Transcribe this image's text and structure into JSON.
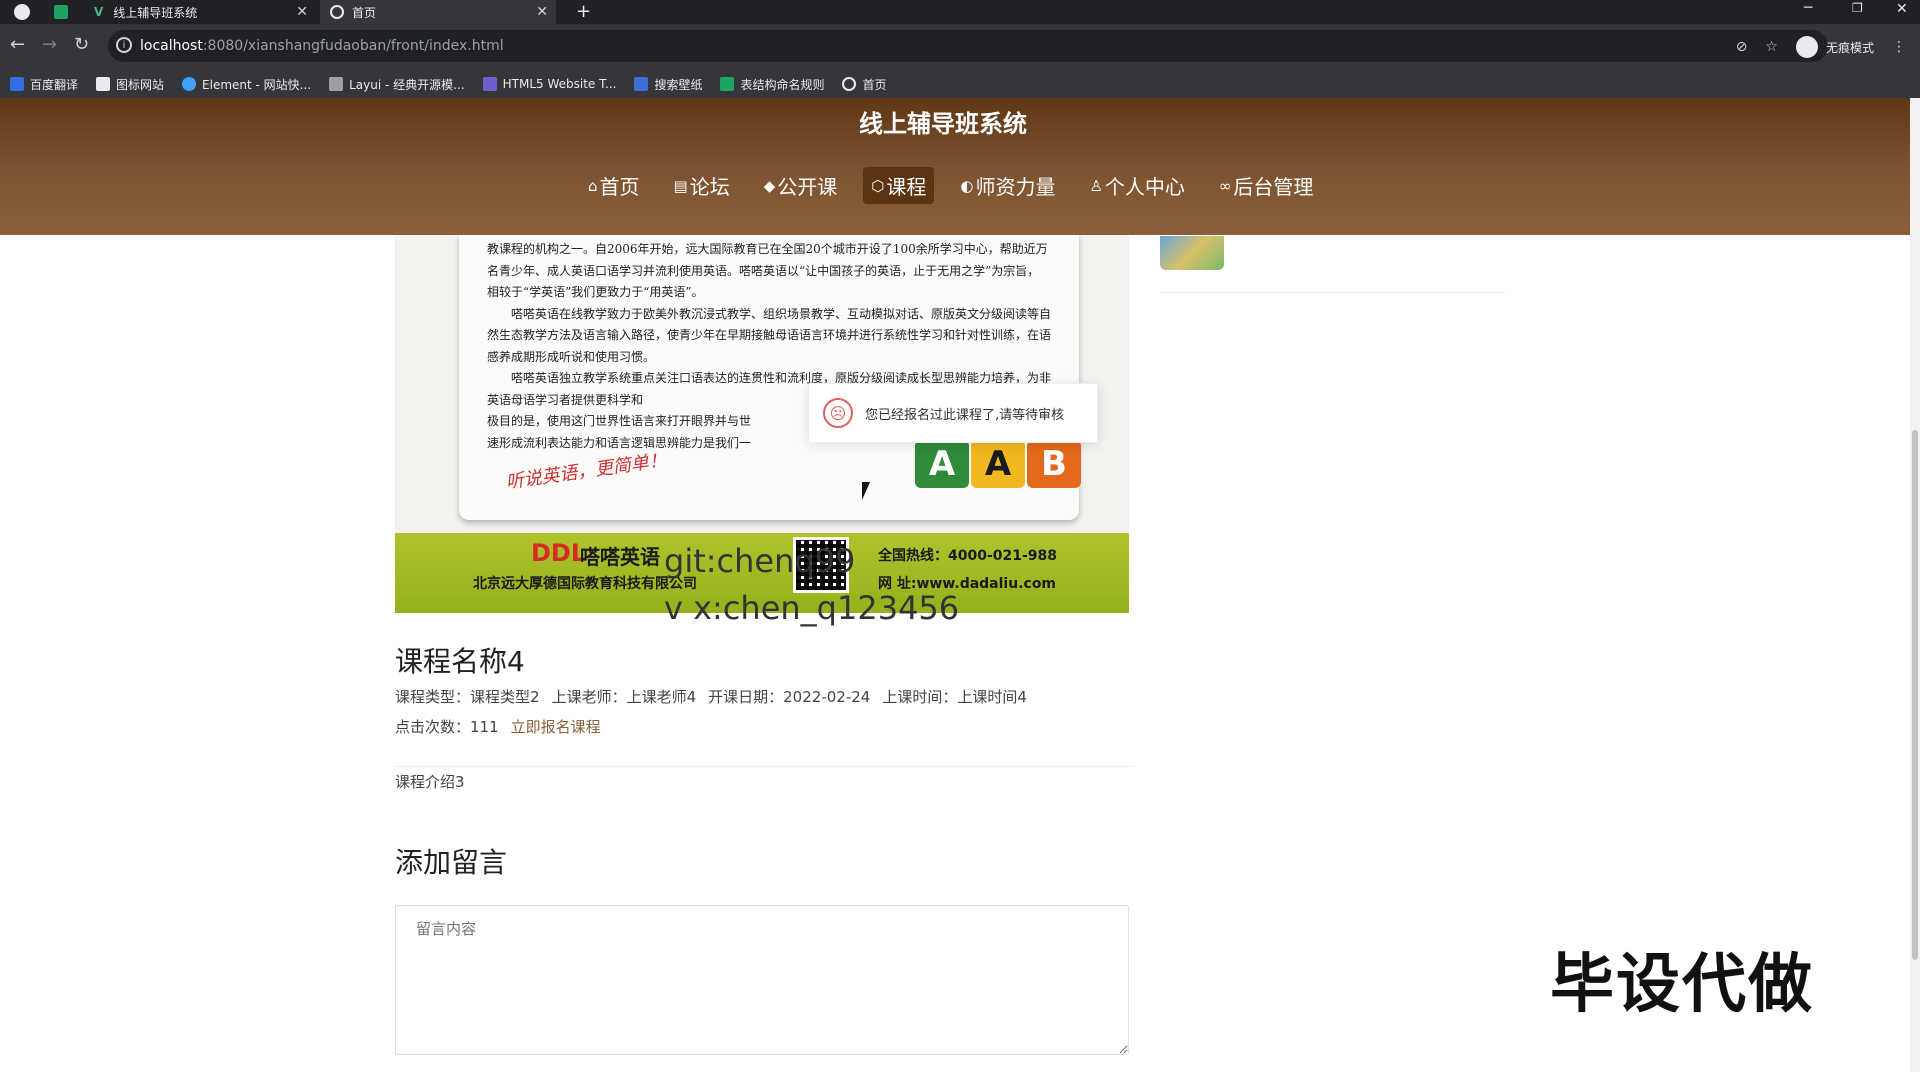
{
  "browser": {
    "tabs": [
      {
        "label": "线上辅导班系统",
        "active": false
      },
      {
        "label": "首页",
        "active": true
      }
    ],
    "url_host": "localhost",
    "url_path": ":8080/xianshangfudaoban/front/index.html",
    "incognito_label": "无痕模式",
    "bookmarks": [
      "百度翻译",
      "图标网站",
      "Element - 网站快...",
      "Layui - 经典开源模...",
      "HTML5 Website T...",
      "搜索壁纸",
      "表结构命名规则",
      "首页"
    ]
  },
  "site": {
    "title": "线上辅导班系统",
    "nav": [
      {
        "label": "首页",
        "icon": "home-icon",
        "active": false
      },
      {
        "label": "论坛",
        "icon": "forum-icon",
        "active": false
      },
      {
        "label": "公开课",
        "icon": "graduation-cap-icon",
        "active": false
      },
      {
        "label": "课程",
        "icon": "course-icon",
        "active": true
      },
      {
        "label": "师资力量",
        "icon": "teacher-icon",
        "active": false
      },
      {
        "label": "个人中心",
        "icon": "user-icon",
        "active": false
      },
      {
        "label": "后台管理",
        "icon": "link-icon",
        "active": false
      }
    ]
  },
  "banner": {
    "paragraphs": [
      "教课程的机构之一。自2006年开始，远大国际教育已在全国20个城市开设了100余所学习中心，帮助近万名青少年、成人英语口语学习并流利使用英语。嗒嗒英语以“让中国孩子的英语，止于无用之学”为宗旨，相较于“学英语”我们更致力于“用英语”。",
      "嗒嗒英语在线教学致力于欧美外教沉浸式教学、组织场景教学、互动模拟对话、原版英文分级阅读等自然生态教学方法及语言输入路径，使青少年在早期接触母语语言环境并进行系统性学习和针对性训练，在语感养成期形成听说和使用习惯。",
      "嗒嗒英语独立教学系统重点关注口语表达的连贯性和流利度，原版分级阅读成长型思辨能力培养，为非英语母语学习者提供更科学和",
      "极目的是，使用这门世界性语言来打开眼界并与世",
      "速形成流利表达能力和语言逻辑思辨能力是我们一"
    ],
    "slogan": "听说英语，更简单！",
    "blocks": [
      "A",
      "A",
      "B"
    ],
    "logo_mark": "DDL",
    "brand_cn": "嗒嗒英语",
    "company": "北京远大厚德国际教育科技有限公司",
    "hotline": "全国热线：4000-021-988",
    "website": "网  址:www.dadaliu.com",
    "watermark_1": "git:chenq",
    "watermark_1b": "99",
    "watermark_2": "v x:chen_q123456"
  },
  "toast": {
    "message": "您已经报名过此课程了,请等待审核",
    "icon": "sad-face-icon"
  },
  "course": {
    "title": "课程名称4",
    "type_label": "课程类型：",
    "type_value": "课程类型2",
    "teacher_label": "上课老师：",
    "teacher_value": "上课老师4",
    "start_label": "开课日期：",
    "start_value": "2022-02-24",
    "time_label": "上课时间：",
    "time_value": "上课时间4",
    "clicks_label": "点击次数：",
    "clicks_value": "111",
    "enroll_link": "立即报名课程",
    "intro": "课程介绍3"
  },
  "comment": {
    "title": "添加留言",
    "placeholder": "留言内容"
  },
  "overlay_stamp": "毕设代做"
}
